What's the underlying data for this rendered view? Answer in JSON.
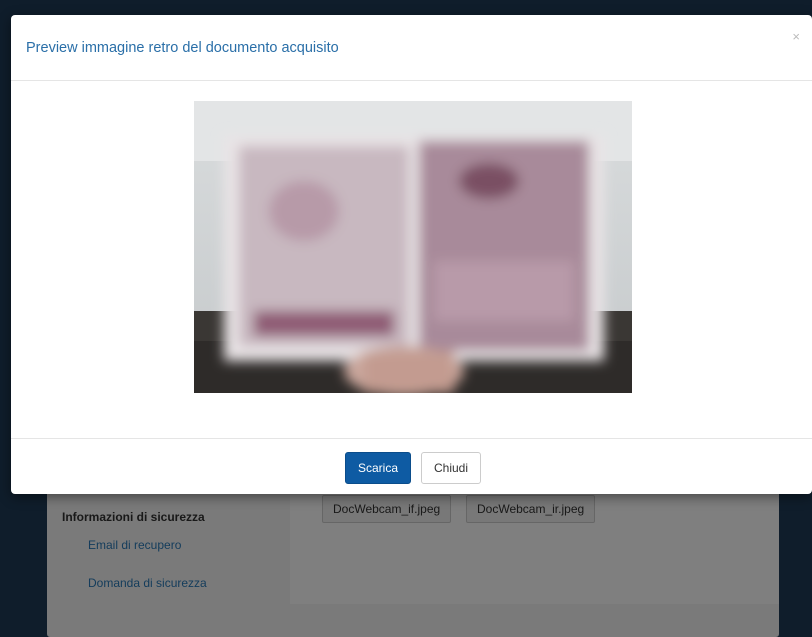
{
  "modal": {
    "title": "Preview immagine retro del documento acquisito",
    "close_label": "×",
    "primary_button": "Scarica",
    "secondary_button": "Chiudi"
  },
  "background": {
    "section_title": "Informazioni di sicurezza",
    "links": [
      "Email di recupero",
      "Domanda di sicurezza"
    ],
    "files": [
      "DocWebcam_if.jpeg",
      "DocWebcam_ir.jpeg"
    ]
  }
}
